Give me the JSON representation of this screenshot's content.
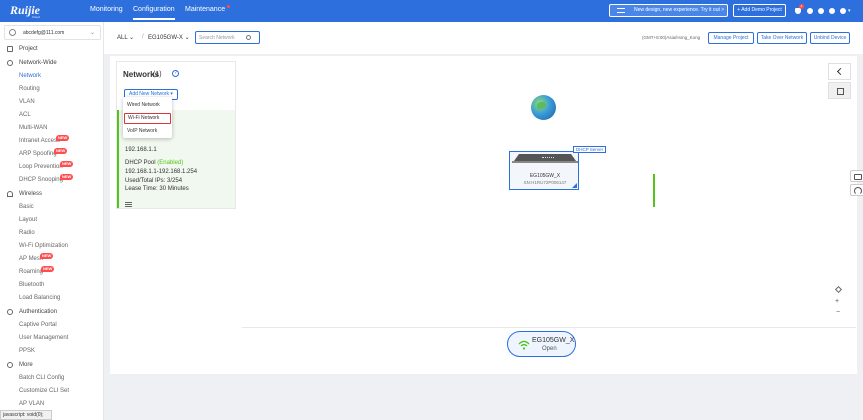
{
  "brand": {
    "name": "Ruijie",
    "tagline": "Cloud",
    "logo_icon": "cloud-logo-icon"
  },
  "topnav": [
    {
      "label": "Monitoring"
    },
    {
      "label": "Configuration"
    },
    {
      "label": "Maintenance"
    }
  ],
  "topbar": {
    "promo": "New design, new experience. Try it out",
    "promo_arrow": ">",
    "add_demo": "+ Add Demo Project",
    "notification_count": "4",
    "accent_color": "#2d6fdc"
  },
  "account": {
    "email": "abcdefg@111.com"
  },
  "sidebar": {
    "project": "Project",
    "groups": [
      {
        "label": "Network-Wide",
        "icon": "globe-icon",
        "items": [
          "Network",
          "Routing",
          "VLAN",
          "ACL",
          "Multi-WAN",
          "Intranet Access",
          "ARP Spoofing",
          "Loop Prevention",
          "DHCP Snooping"
        ]
      },
      {
        "label": "Wireless",
        "icon": "wifi-icon",
        "items": [
          "Basic",
          "Layout",
          "Radio",
          "Wi-Fi Optimization",
          "AP Mesh",
          "Roaming",
          "Bluetooth",
          "Load Balancing"
        ]
      },
      {
        "label": "Authentication",
        "icon": "lock-icon",
        "items": [
          "Captive Portal",
          "User Management",
          "PPSK"
        ]
      },
      {
        "label": "More",
        "icon": "gear-icon",
        "items": [
          "Batch CLI Config",
          "Customize CLI Set",
          "AP VLAN"
        ]
      }
    ],
    "new_badge": "NEW",
    "active_item": "Network"
  },
  "status_hint": "javascript: void(0);",
  "breadcrumb": {
    "scope": "ALL",
    "separator": "/",
    "device": "EG105GW-X"
  },
  "search": {
    "placeholder": "Search Network"
  },
  "timezone": "(GMT+8:00)Asia/Hong_Kong",
  "actions": {
    "manage": "Manage Project",
    "takeover": "Take Over Network",
    "unbind": "Unbind Device"
  },
  "networks": {
    "title": "Networks",
    "count": "(1)",
    "help": "?",
    "add_button": "Add New Network",
    "dropdown": [
      "Wired Network",
      "Wi-Fi Network",
      "VoIP Network"
    ],
    "info": {
      "ip": "192.168.1.1",
      "pool_label": "DHCP Pool",
      "pool_state": "(Enabled)",
      "pool_range": "192.168.1.1-192.168.1.254",
      "used_total": "Used/Total IPs: 3/254",
      "lease": "Lease Time: 30 Minutes"
    }
  },
  "topology": {
    "device_name": "EG105GW_X",
    "device_sn": "SN:H1RU72P006147",
    "tag": "DHCP Server",
    "link_color": "#52c41a"
  },
  "wifi": {
    "ssid": "EG105GW_X",
    "security": "Open"
  }
}
